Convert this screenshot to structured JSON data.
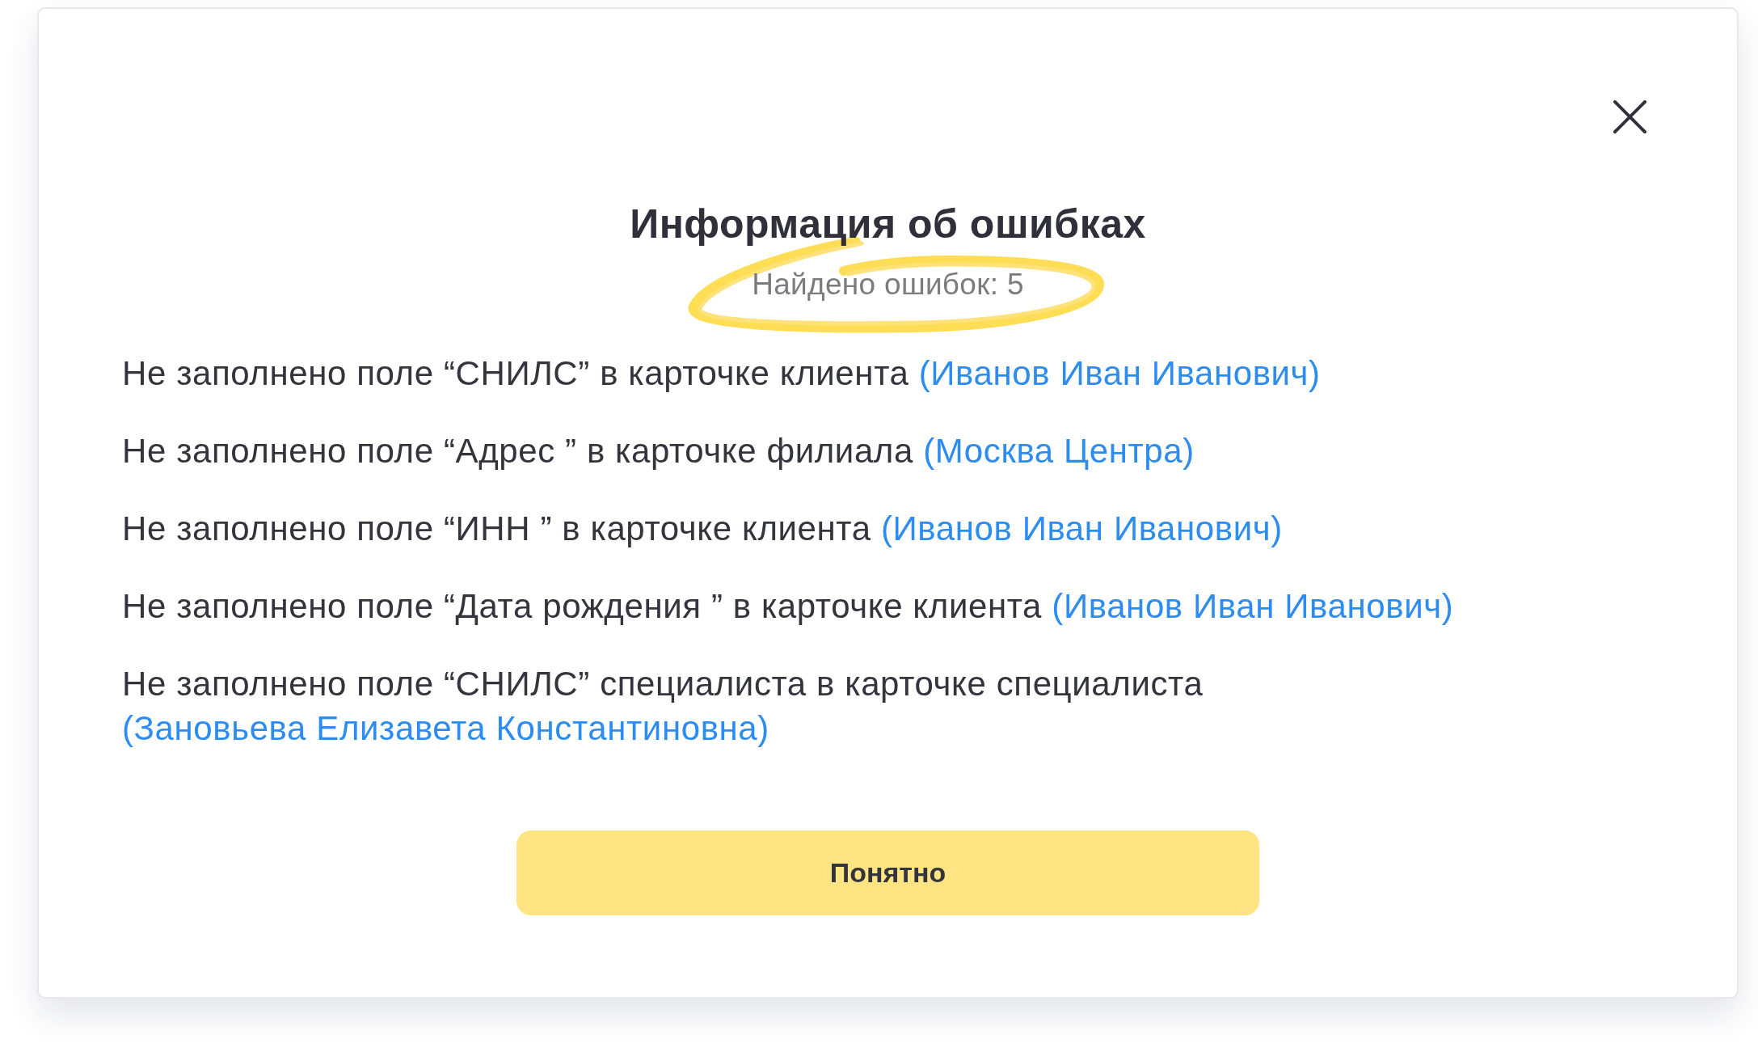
{
  "dialog": {
    "title": "Информация об ошибках",
    "subtitle": "Найдено ошибок: 5",
    "errors": [
      {
        "text": "Не заполнено поле “СНИЛС” в карточке клиента",
        "link": "(Иванов Иван Иванович)"
      },
      {
        "text": "Не заполнено поле “Адрес ” в карточке филиала",
        "link": "(Москва Центра)"
      },
      {
        "text": "Не заполнено поле “ИНН ” в карточке клиента",
        "link": "(Иванов Иван Иванович)"
      },
      {
        "text": "Не заполнено поле “Дата рождения ” в карточке клиента",
        "link": "(Иванов Иван Иванович)"
      },
      {
        "text": "Не заполнено поле “СНИЛС” специалиста в карточке специалиста",
        "link": "(Зановьева Елизавета Константиновна)"
      }
    ],
    "button": "Понятно"
  }
}
